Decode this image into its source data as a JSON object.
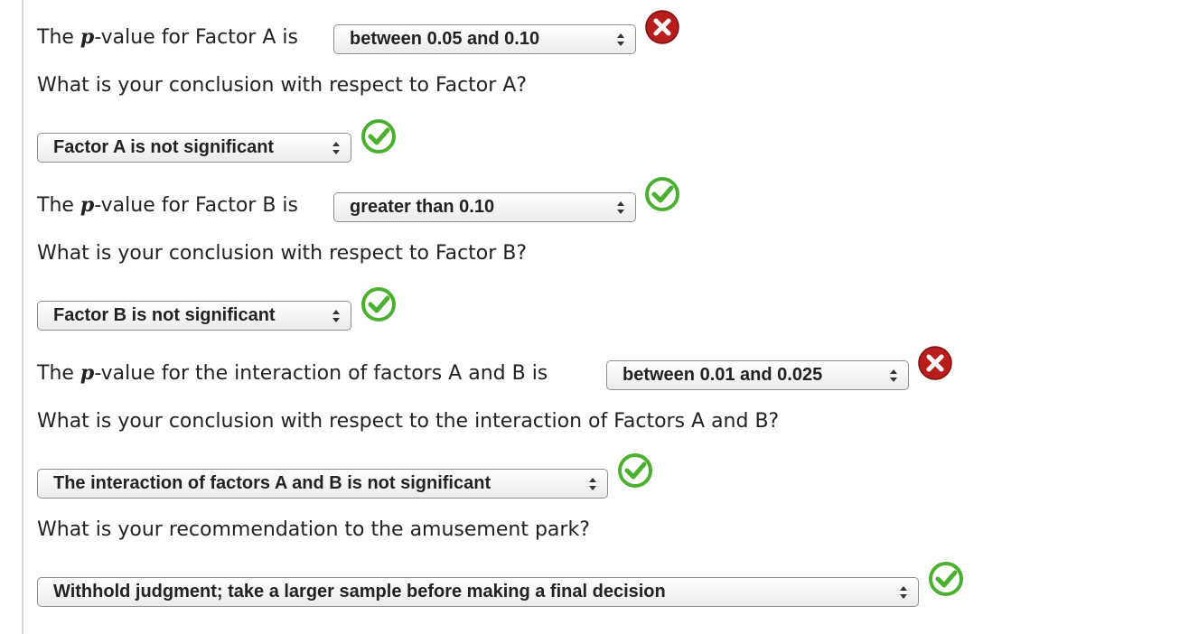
{
  "prefix": {
    "the": "The ",
    "p": "p",
    "value_for": "-value for "
  },
  "factor_a": {
    "pvalue_suffix": "Factor A is",
    "pvalue_selected": "between 0.05 and 0.10",
    "pvalue_status": "incorrect",
    "question": "What is your conclusion with respect to Factor A?",
    "conclusion_selected": "Factor A is not significant",
    "conclusion_status": "correct"
  },
  "factor_b": {
    "pvalue_suffix": "Factor B is",
    "pvalue_selected": "greater than 0.10",
    "pvalue_status": "correct",
    "question": "What is your conclusion with respect to Factor B?",
    "conclusion_selected": "Factor B is not significant",
    "conclusion_status": "correct"
  },
  "interaction": {
    "pvalue_suffix": "the interaction of factors A and B is",
    "pvalue_selected": "between 0.01 and 0.025",
    "pvalue_status": "incorrect",
    "question": "What is your conclusion with respect to the interaction of Factors A and B?",
    "conclusion_selected": "The interaction of factors A and B is not significant",
    "conclusion_status": "correct"
  },
  "recommendation": {
    "question": "What is your recommendation to the amusement park?",
    "selected": "Withhold judgment; take a larger sample before making a final decision",
    "status": "correct"
  },
  "icons": {
    "correct": "check-circle-icon",
    "incorrect": "x-circle-icon"
  },
  "colors": {
    "correct_green": "#4caf2f",
    "incorrect_red": "#b71d1d",
    "select_border": "#8e8e8e",
    "text": "#222222"
  }
}
